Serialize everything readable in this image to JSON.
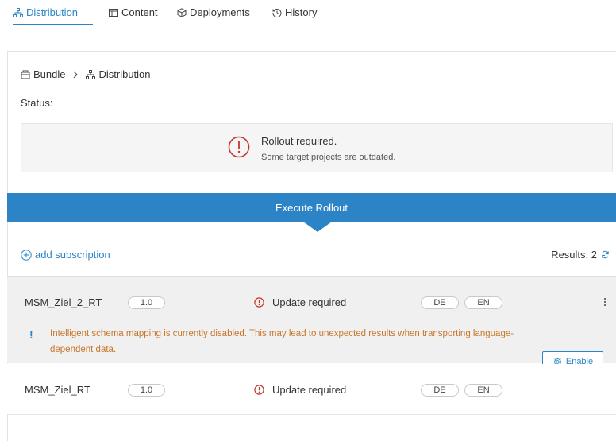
{
  "tabs": [
    {
      "label": "Distribution",
      "icon": "hierarchy-icon",
      "active": true
    },
    {
      "label": "Content",
      "icon": "content-icon",
      "active": false
    },
    {
      "label": "Deployments",
      "icon": "package-icon",
      "active": false
    },
    {
      "label": "History",
      "icon": "history-icon",
      "active": false
    }
  ],
  "breadcrumb": {
    "root": "Bundle",
    "current": "Distribution"
  },
  "status": {
    "label": "Status:",
    "title": "Rollout required.",
    "subtitle": "Some target projects are outdated."
  },
  "rollout": {
    "label": "Execute Rollout"
  },
  "subscriptions": {
    "add_label": "add subscription",
    "results_label": "Results: 2"
  },
  "rows": [
    {
      "name": "MSM_Ziel_2_RT",
      "version": "1.0",
      "status": "Update required",
      "languages": [
        "DE",
        "EN"
      ],
      "warning": "Intelligent schema mapping is currently disabled. This may lead to unexpected results when transporting language-dependent data.",
      "warning_bang": "!",
      "action_label": "Enable"
    },
    {
      "name": "MSM_Ziel_RT",
      "version": "1.0",
      "status": "Update required",
      "languages": [
        "DE",
        "EN"
      ]
    }
  ],
  "colors": {
    "accent": "#2a86c8",
    "button": "#2c84c6",
    "error": "#c0392b",
    "warning": "#c8762a"
  }
}
